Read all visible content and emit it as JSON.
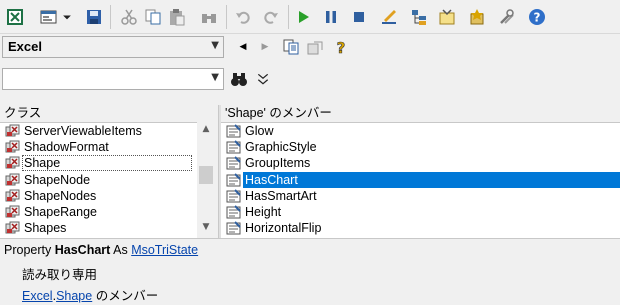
{
  "library": {
    "selected": "Excel"
  },
  "search": {
    "value": "",
    "placeholder": ""
  },
  "classes": {
    "header": "クラス",
    "items": [
      {
        "label": "ServerViewableItems"
      },
      {
        "label": "ShadowFormat"
      },
      {
        "label": "Shape"
      },
      {
        "label": "ShapeNode"
      },
      {
        "label": "ShapeNodes"
      },
      {
        "label": "ShapeRange"
      },
      {
        "label": "Shapes"
      }
    ],
    "selected_index": 2
  },
  "members": {
    "header": "'Shape' のメンバー",
    "items": [
      {
        "label": "Glow"
      },
      {
        "label": "GraphicStyle"
      },
      {
        "label": "GroupItems"
      },
      {
        "label": "HasChart"
      },
      {
        "label": "HasSmartArt"
      },
      {
        "label": "Height"
      },
      {
        "label": "HorizontalFlip"
      }
    ],
    "selected_index": 3
  },
  "detail": {
    "prefix": "Property",
    "member": "HasChart",
    "as_word": "As",
    "type_link": "MsoTriState",
    "readonly": "読み取り専用",
    "lib_link": "Excel",
    "dot": ".",
    "class_link": "Shape",
    "member_of": "のメンバー"
  },
  "colors": {
    "selection": "#0078d7",
    "link": "#0645ad"
  }
}
